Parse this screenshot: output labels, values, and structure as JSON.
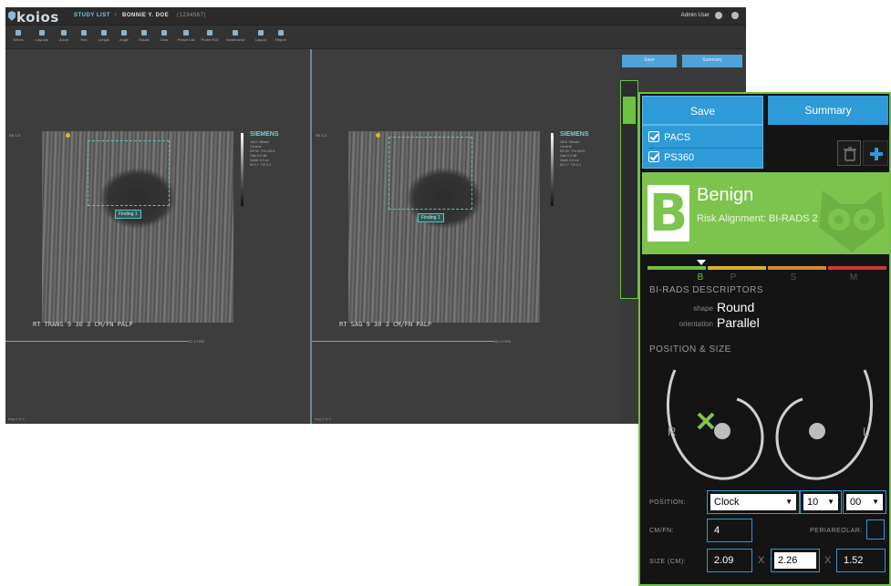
{
  "viewer": {
    "logo": "koios",
    "breadcrumb": {
      "study_list": "STUDY LIST",
      "separator": "/",
      "patient": "BONNIE Y. DOE",
      "patient_id": "(1234567)"
    },
    "user": "Admin User",
    "toolbar": [
      {
        "label": "Series"
      },
      {
        "label": "Layouts"
      },
      {
        "label": "Zoom"
      },
      {
        "label": "Pan"
      },
      {
        "label": "Length"
      },
      {
        "label": "Angle"
      },
      {
        "label": "Rotate"
      },
      {
        "label": "Clear"
      },
      {
        "label": "Preset List"
      },
      {
        "label": "Probe ROI"
      },
      {
        "label": "Screenshot"
      },
      {
        "label": "Layout"
      },
      {
        "label": "Report"
      }
    ],
    "background_buttons": {
      "save": "Save",
      "summary": "Summary"
    },
    "left_image": {
      "manufacturer": "SIEMENS",
      "caption": "RT TRANS 9 30 3 CM/FN PALP",
      "finding_label": "Finding 1",
      "footer": "Img 1 of 2"
    },
    "right_image": {
      "manufacturer": "SIEMENS",
      "caption": "RT SAG 9 30 3 CM/FN PALP",
      "finding_label": "Finding 1",
      "footer": "Img 2 of 2"
    }
  },
  "panel": {
    "save_label": "Save",
    "summary_label": "Summary",
    "save_targets": [
      {
        "label": "PACS",
        "checked": true
      },
      {
        "label": "PS360",
        "checked": true
      }
    ],
    "result": {
      "letter": "B",
      "title": "Benign",
      "alignment": "Risk Alignment: BI-RADS 2"
    },
    "risk_scale": {
      "labels": [
        "B",
        "P",
        "S",
        "M"
      ],
      "colors": [
        "#6cc33f",
        "#d9b227",
        "#d08a2a",
        "#c83a3a"
      ],
      "selected": "B"
    },
    "birads": {
      "title": "BI-RADS DESCRIPTORS",
      "shape_label": "shape",
      "shape_value": "Round",
      "orientation_label": "orientation",
      "orientation_value": "Parallel"
    },
    "position_size": {
      "title": "POSITION & SIZE",
      "right_side": "R",
      "left_side": "L",
      "marker_color": "#7dc44e"
    },
    "form": {
      "position_label": "POSITION:",
      "position_value": "Clock",
      "hour_value": "10",
      "minute_value": "00",
      "cmfn_label": "CM/FN:",
      "cmfn_value": "4",
      "periareolar_label": "PERIAREOLAR:",
      "size_label": "SIZE (CM):",
      "size_1": "2.09",
      "size_2": "2.26",
      "size_3": "1.52",
      "times": "X"
    },
    "accent_color": "#6cc33f",
    "button_color": "#2e9ad8"
  }
}
